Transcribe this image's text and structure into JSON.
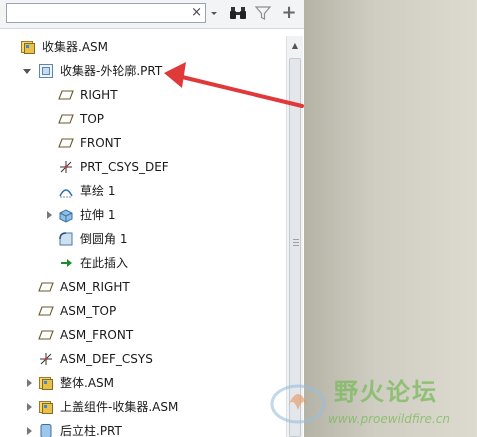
{
  "search": {
    "value": "",
    "placeholder": "",
    "clear_glyph": "×"
  },
  "toolbar": {
    "dropdown_icon": "chevron-down-icon",
    "find_icon": "binoculars-icon",
    "filter_icon": "filter-icon",
    "add_icon": "plus-icon",
    "add_glyph": "+"
  },
  "tree": {
    "root": {
      "label": "收集器.ASM",
      "icon": "assembly-icon"
    },
    "part": {
      "label": "收集器-外轮廓.PRT",
      "icon": "part-icon",
      "expanded": true
    },
    "part_children": [
      {
        "label": "RIGHT",
        "icon": "datum-plane-icon"
      },
      {
        "label": "TOP",
        "icon": "datum-plane-icon"
      },
      {
        "label": "FRONT",
        "icon": "datum-plane-icon"
      },
      {
        "label": "PRT_CSYS_DEF",
        "icon": "coordinate-system-icon"
      },
      {
        "label": "草绘 1",
        "icon": "sketch-icon"
      },
      {
        "label": "拉伸 1",
        "icon": "extrude-icon",
        "collapsed": true
      },
      {
        "label": "倒圆角 1",
        "icon": "round-icon"
      },
      {
        "label": "在此插入",
        "icon": "insert-here-icon"
      }
    ],
    "asm_features": [
      {
        "label": "ASM_RIGHT",
        "icon": "datum-plane-icon"
      },
      {
        "label": "ASM_TOP",
        "icon": "datum-plane-icon"
      },
      {
        "label": "ASM_FRONT",
        "icon": "datum-plane-icon"
      },
      {
        "label": "ASM_DEF_CSYS",
        "icon": "coordinate-system-icon"
      }
    ],
    "sub_components": [
      {
        "label": "整体.ASM",
        "icon": "assembly-icon"
      },
      {
        "label": "上盖组件-收集器.ASM",
        "icon": "assembly-icon"
      },
      {
        "label": "后立柱.PRT",
        "icon": "part-icon"
      }
    ]
  },
  "annotation": {
    "color": "#e0393a"
  },
  "watermark": {
    "title": "野火论坛",
    "url": "www.proewildfire.cn",
    "color": "#78b95a"
  }
}
